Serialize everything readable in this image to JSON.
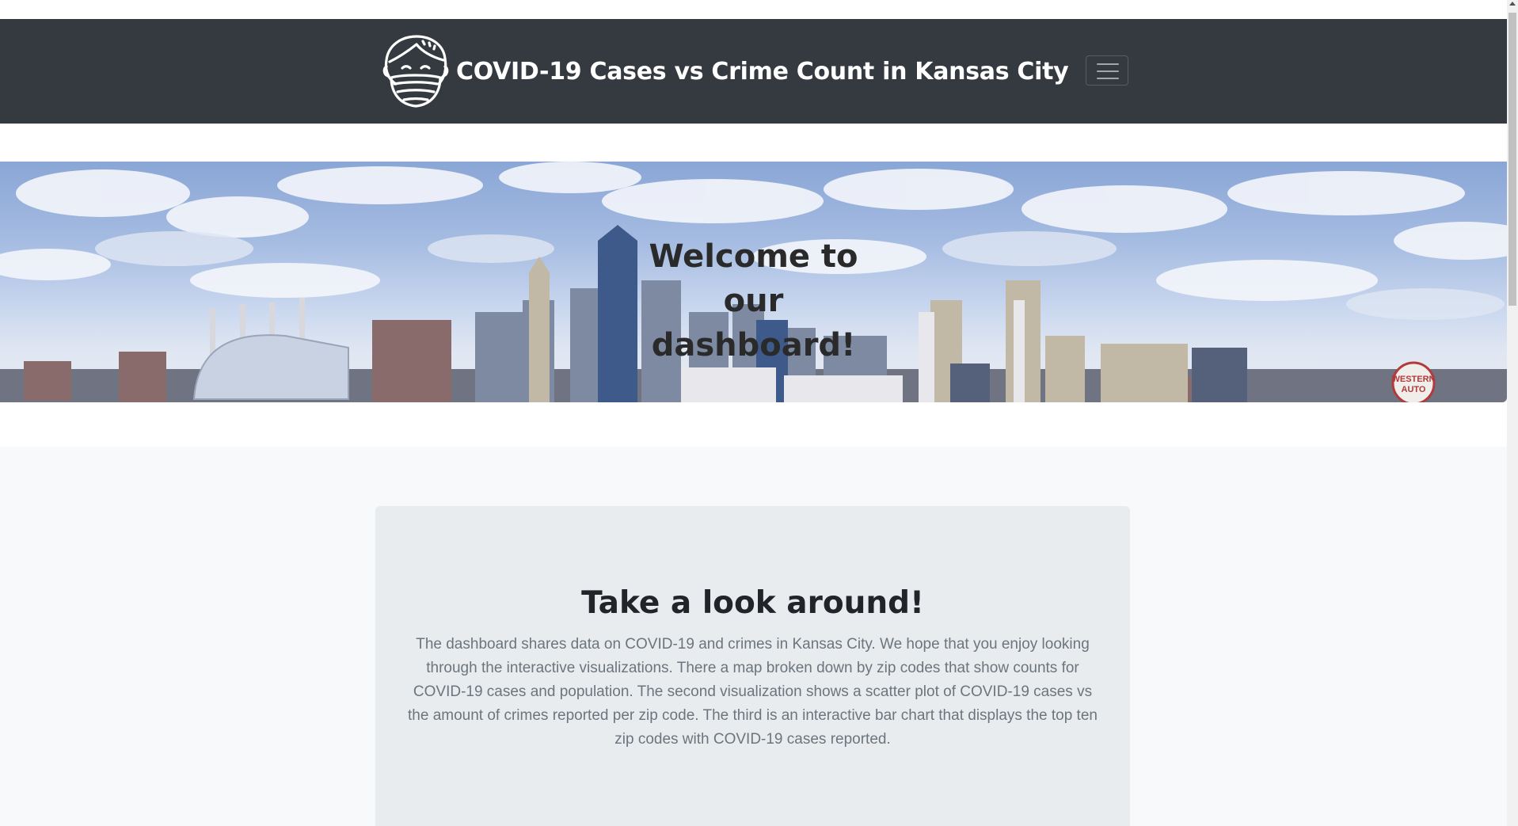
{
  "navbar": {
    "title": "COVID-19 Cases vs Crime Count in Kansas City",
    "logo_icon": "face-mask-icon",
    "toggle_icon": "hamburger-menu-icon",
    "background": "#343a40"
  },
  "hero": {
    "title": "Welcome to our dashboard!",
    "sign_text": "WESTERN AUTO"
  },
  "intro_card": {
    "title": "Take a look around!",
    "text": "The dashboard shares data on COVID-19 and crimes in Kansas City. We hope that you enjoy looking through the interactive visualizations. There a map broken down by zip codes that show counts for COVID-19 cases and population. The second visualization shows a scatter plot of COVID-19 cases vs the amount of crimes reported per zip code. The third is an interactive bar chart that displays the top ten zip codes with COVID-19 cases reported."
  }
}
